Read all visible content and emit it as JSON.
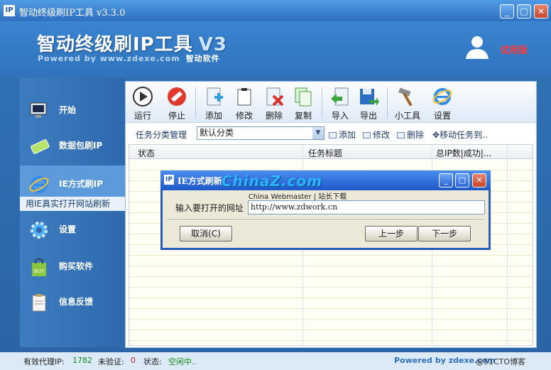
{
  "window": {
    "title": "智动终级刷IP工具  v3.3.0",
    "logo": "IP",
    "buttons": [
      "minimize-icon",
      "maximize-icon",
      "close-icon"
    ]
  },
  "banner": {
    "product": "智动终级刷IP工具",
    "version": "V3",
    "powered": "Powered by www.zdexe.com",
    "company": "智动软件",
    "edition": "试用版"
  },
  "sidebar": {
    "items": [
      {
        "label": "开始",
        "icon": "monitor-icon"
      },
      {
        "label": "数据包刷IP",
        "icon": "eraser-icon"
      },
      {
        "label": "IE方式刷IP",
        "icon": "ie-icon",
        "sub": "用IE真实打开网站刷新"
      },
      {
        "label": "设置",
        "icon": "gear-icon"
      },
      {
        "label": "购买软件",
        "icon": "buy-bag-icon"
      },
      {
        "label": "信息反馈",
        "icon": "clipboard-icon"
      }
    ]
  },
  "toolbar": {
    "run": "运行",
    "stop": "停止",
    "add": "添加",
    "edit": "修改",
    "delete": "删除",
    "copy": "复制",
    "import": "导入",
    "export": "导出",
    "tools": "小工具",
    "settings": "设置"
  },
  "category": {
    "label": "任务分类管理",
    "selected": "默认分类",
    "add": "添加",
    "edit": "修改",
    "delete": "删除",
    "move": "移动任务到.."
  },
  "table": {
    "columns": [
      "状态",
      "任务标题",
      "总IP数|成功|..."
    ]
  },
  "dialog": {
    "title": "IE方式刷新",
    "watermark_sub": "China Webmaster | 站长下载",
    "watermark_logo": "ChinaZ.com",
    "url_label": "输入要打开的网址",
    "url_value": "http://www.zdwork.cn",
    "cancel": "取消(C)",
    "prev": "上一步",
    "next": "下一步"
  },
  "status": {
    "proxy_label": "有效代理IP:",
    "proxy_count": "1782",
    "unverified_label": "未验证:",
    "unverified_count": "0",
    "state_label": "状态:",
    "state_value": "空闲中..",
    "powered": "Powered by zdexe.com",
    "watermark": "@51CTO博客"
  },
  "colors": {
    "accent": "#2f71b5",
    "trial": "#ff3b3b",
    "status_ok": "#0f8b1a",
    "status_alert": "#d22020"
  }
}
